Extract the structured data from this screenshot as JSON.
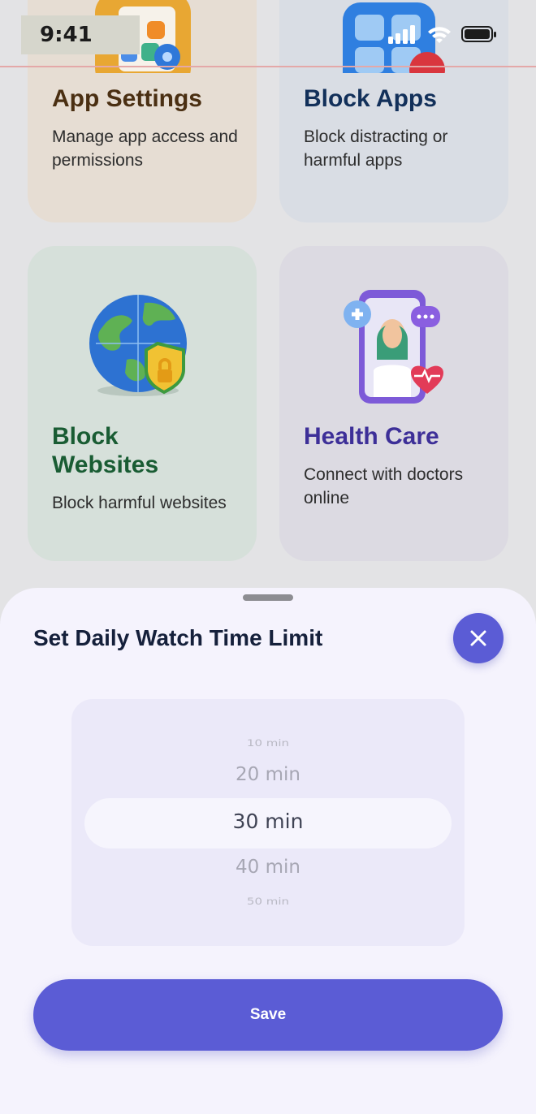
{
  "status_bar": {
    "time": "9:41",
    "icons": [
      "cellular-signal-icon",
      "wifi-icon",
      "battery-icon"
    ]
  },
  "cards": {
    "app_settings": {
      "title": "App Settings",
      "description": "Manage app access and permissions",
      "icon": "app-settings-icon",
      "bg_color": "#e6ddd3",
      "title_color": "#4a2f12"
    },
    "block_apps": {
      "title": "Block Apps",
      "description": "Block distracting or harmful apps",
      "icon": "block-apps-icon",
      "bg_color": "#d9dde4",
      "title_color": "#12305a"
    },
    "block_websites": {
      "title": "Block Websites",
      "description": "Block harmful websites",
      "icon": "globe-shield-icon",
      "bg_color": "#d6e0da",
      "title_color": "#195c33"
    },
    "health_care": {
      "title": "Health Care",
      "description": "Connect with doctors online",
      "icon": "doctor-phone-icon",
      "bg_color": "#dcdae2",
      "title_color": "#3d2f98"
    }
  },
  "sheet": {
    "title": "Set Daily Watch Time Limit",
    "picker": {
      "options": [
        "10 min",
        "20 min",
        "30 min",
        "40 min",
        "50 min"
      ],
      "selected": "30 min"
    },
    "save_label": "Save",
    "accent_color": "#5b5cd5"
  }
}
